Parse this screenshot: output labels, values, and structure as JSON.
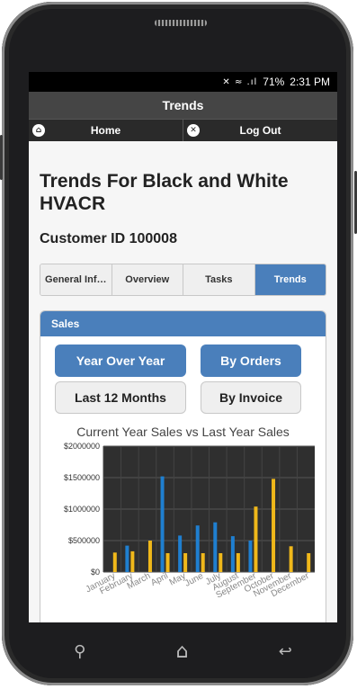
{
  "status_bar": {
    "icons": "✕ ≈ .ıl",
    "battery": "71%",
    "time": "2:31 PM"
  },
  "header": {
    "title": "Trends"
  },
  "nav": {
    "home_label": "Home",
    "home_icon": "home-icon",
    "logout_label": "Log Out",
    "logout_icon": "close-icon"
  },
  "page": {
    "title": "Trends For Black and White HVACR",
    "customer_id": "Customer ID 100008"
  },
  "tabs": [
    {
      "label": "General Inf…",
      "active": false
    },
    {
      "label": "Overview",
      "active": false
    },
    {
      "label": "Tasks",
      "active": false
    },
    {
      "label": "Trends",
      "active": true
    }
  ],
  "sales_panel": {
    "title": "Sales",
    "buttons": {
      "year_over_year": "Year Over Year",
      "by_orders": "By Orders",
      "last_12_months": "Last 12 Months",
      "by_invoice": "By Invoice"
    }
  },
  "chart_data": {
    "type": "bar",
    "title": "Current Year Sales vs Last Year Sales",
    "categories": [
      "January",
      "February",
      "March",
      "April",
      "May",
      "June",
      "July",
      "August",
      "September",
      "October",
      "November",
      "December"
    ],
    "series": [
      {
        "color": "#1f7fd0",
        "values": [
          0,
          420000,
          0,
          1520000,
          580000,
          740000,
          790000,
          570000,
          500000,
          0,
          0,
          0
        ]
      },
      {
        "color": "#f0b81a",
        "values": [
          310000,
          330000,
          500000,
          300000,
          300000,
          300000,
          300000,
          300000,
          1040000,
          1480000,
          410000,
          300000
        ]
      }
    ],
    "y_ticks": [
      "$0",
      "$500000",
      "$1000000",
      "$1500000",
      "$2000000"
    ],
    "ylim": [
      0,
      2000000
    ],
    "grid": true
  },
  "colors": {
    "accent": "#4a7fbb",
    "chart_bg": "#2f2f2f"
  },
  "home_bar": {
    "back_icon": "search-icon",
    "home_icon": "home-outline-icon",
    "recent_icon": "back-arrow-icon"
  }
}
